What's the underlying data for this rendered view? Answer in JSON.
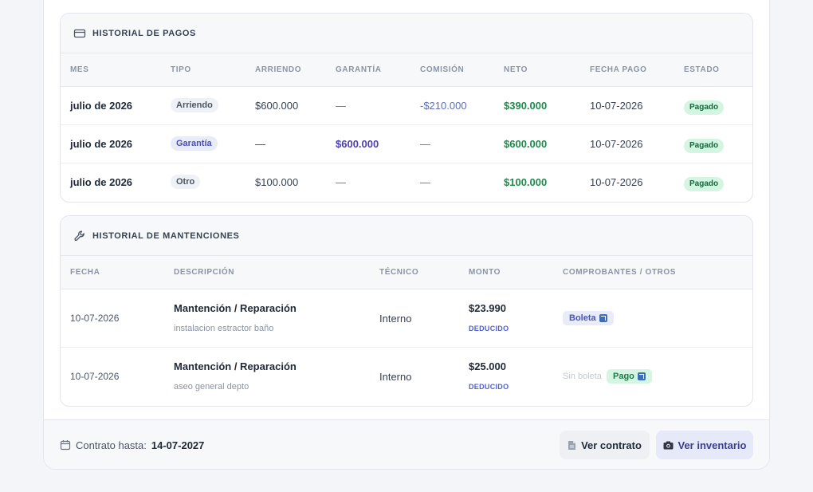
{
  "pagos": {
    "title": "HISTORIAL DE PAGOS",
    "columns": [
      "MES",
      "TIPO",
      "ARRIENDO",
      "GARANTÍA",
      "COMISIÓN",
      "NETO",
      "FECHA PAGO",
      "ESTADO"
    ],
    "rows": [
      {
        "mes": "julio de 2026",
        "tipo": "Arriendo",
        "arriendo": "$600.000",
        "garantia": "—",
        "comision": "-$210.000",
        "neto": "$390.000",
        "fecha": "10-07-2026",
        "estado": "Pagado"
      },
      {
        "mes": "julio de 2026",
        "tipo": "Garantía",
        "arriendo": "—",
        "garantia": "$600.000",
        "comision": "—",
        "neto": "$600.000",
        "fecha": "10-07-2026",
        "estado": "Pagado"
      },
      {
        "mes": "julio de 2026",
        "tipo": "Otro",
        "arriendo": "$100.000",
        "garantia": "—",
        "comision": "—",
        "neto": "$100.000",
        "fecha": "10-07-2026",
        "estado": "Pagado"
      }
    ]
  },
  "mantenciones": {
    "title": "HISTORIAL DE MANTENCIONES",
    "columns": [
      "FECHA",
      "DESCRIPCIÓN",
      "TÉCNICO",
      "MONTO",
      "COMPROBANTES / OTROS"
    ],
    "rows": [
      {
        "fecha": "10-07-2026",
        "titulo": "Mantención / Reparación",
        "detalle": "instalacion estractor baño",
        "tecnico": "Interno",
        "monto": "$23.990",
        "estado_monto": "DEDUCIDO",
        "sin_boleta": "",
        "comprobante": "Boleta"
      },
      {
        "fecha": "10-07-2026",
        "titulo": "Mantención / Reparación",
        "detalle": "aseo general depto",
        "tecnico": "Interno",
        "monto": "$25.000",
        "estado_monto": "DEDUCIDO",
        "sin_boleta": "Sin boleta",
        "comprobante": "Pago"
      }
    ]
  },
  "footer": {
    "contract_label": "Contrato hasta:",
    "contract_date": "14-07-2027",
    "btn_contrato": "Ver contrato",
    "btn_inventario": "Ver inventario"
  },
  "icons": {
    "pagos": "credit-card-icon",
    "mantenciones": "wrench-icon",
    "calendar": "calendar-icon",
    "document": "document-icon",
    "camera": "camera-icon",
    "external": "external-link-icon"
  },
  "colors": {
    "green": "#1f8a4c",
    "indigo": "#4c3fb0",
    "pill_green_bg": "#d5f5e3",
    "pill_indigo_bg": "#e8ebf8"
  }
}
